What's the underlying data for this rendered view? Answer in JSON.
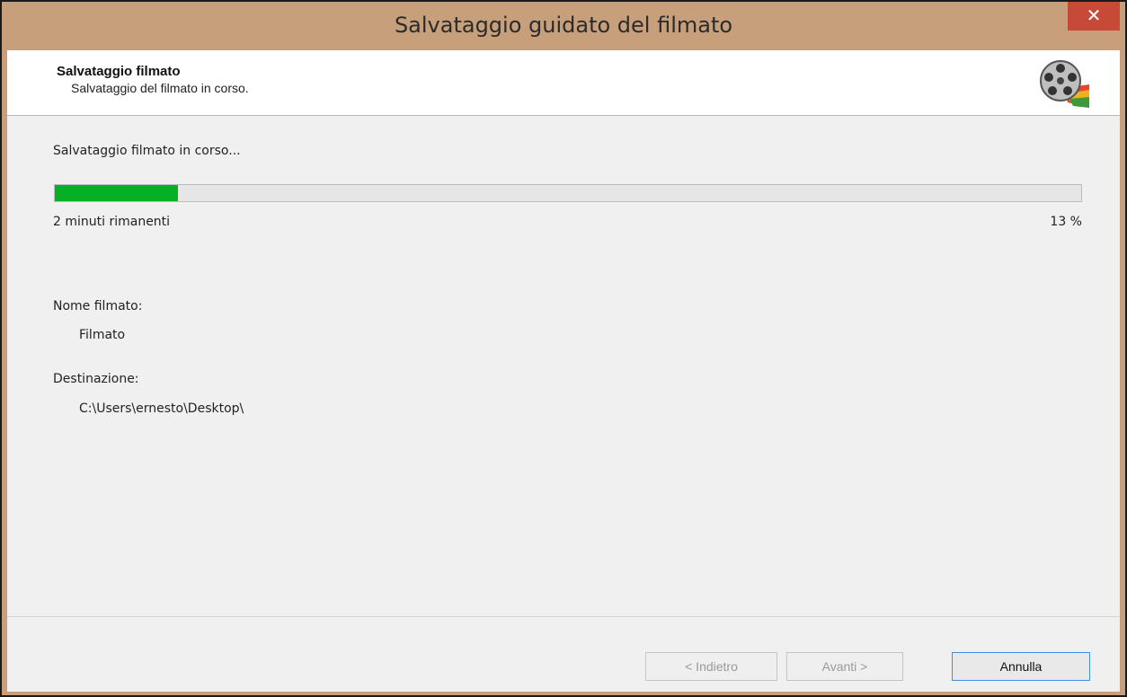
{
  "window": {
    "title": "Salvataggio guidato del filmato",
    "close_glyph": "✕"
  },
  "header": {
    "title": "Salvataggio filmato",
    "subtitle": "Salvataggio del filmato in corso.",
    "icon": "film-reel-icon"
  },
  "progress": {
    "status": "Salvataggio filmato in corso...",
    "remaining": "2 minuti rimanenti",
    "percent_label": "13 %",
    "fraction": 0.12,
    "color": "#06b025"
  },
  "details": {
    "name_label": "Nome filmato:",
    "name_value": "Filmato",
    "destination_label": "Destinazione:",
    "destination_value": "C:\\Users\\ernesto\\Desktop\\"
  },
  "buttons": {
    "back": "< Indietro",
    "next": "Avanti >",
    "cancel": "Annulla"
  }
}
